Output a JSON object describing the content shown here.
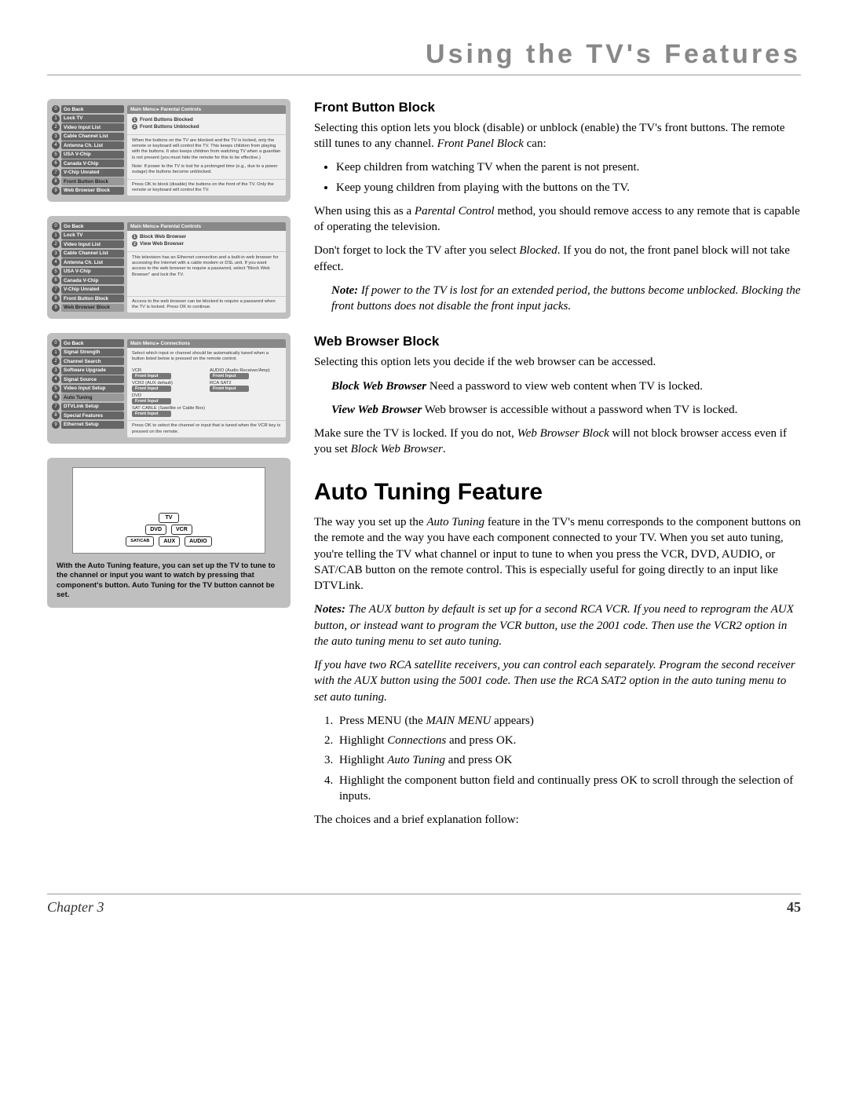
{
  "pageTitle": "Using the TV's Features",
  "footer": {
    "chapter": "Chapter 3",
    "page": "45"
  },
  "screen1": {
    "breadcrumb": "Main Menu ▸ Parental Controls",
    "menu": [
      {
        "n": "0",
        "label": "Go Back",
        "active": false
      },
      {
        "n": "1",
        "label": "Lock TV",
        "active": false
      },
      {
        "n": "2",
        "label": "Video Input List",
        "active": false
      },
      {
        "n": "3",
        "label": "Cable Channel List",
        "active": false
      },
      {
        "n": "4",
        "label": "Antenna Ch. List",
        "active": false
      },
      {
        "n": "5",
        "label": "USA V-Chip",
        "active": false
      },
      {
        "n": "6",
        "label": "Canada V-Chip",
        "active": false
      },
      {
        "n": "7",
        "label": "V-Chip Unrated",
        "active": false
      },
      {
        "n": "8",
        "label": "Front Button Block",
        "active": true
      },
      {
        "n": "9",
        "label": "Web Browser Block",
        "active": false
      }
    ],
    "options": [
      {
        "n": "1",
        "label": "Front Buttons Blocked"
      },
      {
        "n": "2",
        "label": "Front Buttons Unblocked"
      }
    ],
    "desc": "When the buttons on the TV are blocked and the TV is locked, only the remote or keyboard will control the TV. This keeps children from playing with the buttons. It also keeps children from watching TV when a guardian is not present (you must hide the remote for this to be effective.)",
    "note": "Note: If power to the TV is lost for a prolonged time (e.g., due to a power outage) the buttons become unblocked.",
    "help": "Press OK to block (disable) the buttons on the front of the TV. Only the remote or keyboard will control the TV."
  },
  "screen2": {
    "breadcrumb": "Main Menu ▸ Parental Controls",
    "menu": [
      {
        "n": "0",
        "label": "Go Back",
        "active": false
      },
      {
        "n": "1",
        "label": "Lock TV",
        "active": false
      },
      {
        "n": "2",
        "label": "Video Input List",
        "active": false
      },
      {
        "n": "3",
        "label": "Cable Channel List",
        "active": false
      },
      {
        "n": "4",
        "label": "Antenna Ch. List",
        "active": false
      },
      {
        "n": "5",
        "label": "USA V-Chip",
        "active": false
      },
      {
        "n": "6",
        "label": "Canada V-Chip",
        "active": false
      },
      {
        "n": "7",
        "label": "V-Chip Unrated",
        "active": false
      },
      {
        "n": "8",
        "label": "Front Button Block",
        "active": false
      },
      {
        "n": "9",
        "label": "Web Browser Block",
        "active": true
      }
    ],
    "options": [
      {
        "n": "1",
        "label": "Block Web Browser"
      },
      {
        "n": "2",
        "label": "View Web Browser"
      }
    ],
    "desc": "This television has an Ethernet connection and a built-in web browser for accessing the Internet with a cable modem or DSL unit.  If you want access to the web browser to require a password, select \"Block Web Browser\" and lock the TV.",
    "help": "Access to the web browser can be blocked to require a password when the TV is locked. Press OK to continue."
  },
  "screen3": {
    "breadcrumb": "Main Menu ▸ Connections",
    "menu": [
      {
        "n": "0",
        "label": "Go Back",
        "active": false
      },
      {
        "n": "1",
        "label": "Signal Strength",
        "active": false
      },
      {
        "n": "2",
        "label": "Channel Search",
        "active": false
      },
      {
        "n": "3",
        "label": "Software Upgrade",
        "active": false
      },
      {
        "n": "4",
        "label": "Signal Source",
        "active": false
      },
      {
        "n": "5",
        "label": "Video Input Setup",
        "active": false
      },
      {
        "n": "6",
        "label": "Auto Tuning",
        "active": true
      },
      {
        "n": "7",
        "label": "DTVLink Setup",
        "active": false
      },
      {
        "n": "8",
        "label": "Special Features",
        "active": false
      },
      {
        "n": "9",
        "label": "Ethernet Setup",
        "active": false
      }
    ],
    "intro": "Select which input or channel should be automatically tuned when a button listed below is pressed on the remote control.",
    "rows": [
      {
        "l": "VCR",
        "lf": "Front Input",
        "r": "AUDIO (Audio Receiver/Amp)",
        "rf": "Front Input"
      },
      {
        "l": "VCR2 (AUX default)",
        "lf": "Front Input",
        "r": "RCA SAT2",
        "rf": "Front Input"
      },
      {
        "l": "DVD",
        "lf": "Front Input",
        "r": "",
        "rf": ""
      },
      {
        "l": "SAT·CABLE (Satellite or Cable Box)",
        "lf": "Front Input",
        "r": "",
        "rf": "",
        "full": true
      }
    ],
    "help": "Press OK to select the channel or input that is tuned when the VCR key is pressed on the remote."
  },
  "remote": {
    "row1": [
      "TV"
    ],
    "row2": [
      "DVD",
      "VCR"
    ],
    "row3": [
      "SAT/CAB",
      "AUX",
      "AUDIO"
    ],
    "caption": "With the Auto Tuning feature, you can set up the TV to tune to the channel or input you want to watch by pressing that component's button. Auto Tuning for the TV button cannot be set."
  },
  "sections": {
    "fbb": {
      "h": "Front Button Block",
      "p1": "Selecting this option lets you block (disable) or unblock (enable) the TV's front buttons. The remote still tunes to any channel. ",
      "p1_em": "Front Panel Block",
      "p1_tail": " can:",
      "li1": "Keep children from watching TV when the parent is not present.",
      "li2": "Keep young children from playing with the buttons on the TV.",
      "p2a": "When using this as a ",
      "p2em": "Parental Control",
      "p2b": " method, you should remove access to any remote that is capable of operating the television.",
      "p3a": "Don't forget to lock the TV after you select ",
      "p3em": "Blocked",
      "p3b": ". If you do not, the front panel block will not take effect.",
      "note": "Note:",
      "noteText": " If power to the TV is lost for an extended period, the buttons become unblocked. Blocking the front buttons does not disable the front input jacks."
    },
    "wbb": {
      "h": "Web Browser Block",
      "p1": "Selecting this option lets you decide if the web browser can be accessed.",
      "t1": "Block Web Browser",
      "t1txt": "   Need a password to view web content when TV is locked.",
      "t2": "View Web Browser",
      "t2txt": "    Web browser is accessible without a password when TV is locked.",
      "p3a": "Make sure the TV is locked. If you do not, ",
      "p3em": "Web Browser Block",
      "p3b": " will not block browser access even if you set ",
      "p3em2": "Block Web Browser",
      "p3c": "."
    },
    "atf": {
      "h": "Auto Tuning Feature",
      "p1a": "The way you set up the ",
      "p1em": "Auto Tuning",
      "p1b": " feature in the TV's menu corresponds to the component buttons on the remote and the way you have each component connected to your TV. When you set auto tuning, you're telling the TV what channel or input to tune to when you press the VCR, DVD, AUDIO, or SAT/CAB button on the remote control. This is especially useful for going directly to an input like DTVLink.",
      "note1h": "Notes:",
      "note1": " The AUX button by default is set up for a second RCA VCR. If you need to reprogram the AUX button, or instead want to program the VCR button, use the 2001 code. Then use the VCR2 option in the auto tuning menu to set auto tuning.",
      "note2": "If you have two RCA satellite receivers, you can control each separately. Program the second receiver with the AUX button using the 5001 code. Then use the RCA SAT2 option in the auto tuning menu to set auto tuning.",
      "ol1a": "Press MENU (the ",
      "ol1em": "MAIN MENU",
      "ol1b": " appears)",
      "ol2a": "Highlight ",
      "ol2em": "Connections",
      "ol2b": " and press OK.",
      "ol3a": "Highlight ",
      "ol3em": "Auto Tuning",
      "ol3b": " and press OK",
      "ol4": "Highlight the component button field and continually press OK to scroll through the selection of inputs.",
      "pend": "The choices and a brief explanation follow:"
    }
  }
}
